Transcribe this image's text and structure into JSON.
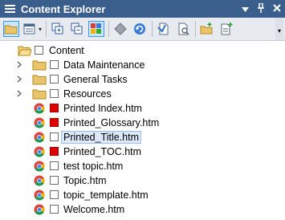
{
  "window": {
    "title": "Content Explorer",
    "pin_glyph": "⌄",
    "pushpin_glyph": "†",
    "close_glyph": "✕"
  },
  "toolbar": {
    "overflow_glyph": "▾"
  },
  "tree": {
    "root": {
      "label": "Content",
      "icon": "open-folder-icon"
    },
    "items": [
      {
        "label": "Data Maintenance",
        "icon": "folder-icon",
        "expandable": true,
        "checkbox": "empty"
      },
      {
        "label": "General Tasks",
        "icon": "folder-icon",
        "expandable": true,
        "checkbox": "empty"
      },
      {
        "label": "Resources",
        "icon": "folder-icon",
        "expandable": true,
        "checkbox": "empty"
      },
      {
        "label": "Printed Index.htm",
        "icon": "chrome-icon",
        "checkbox": "red"
      },
      {
        "label": "Printed_Glossary.htm",
        "icon": "chrome-icon",
        "checkbox": "red"
      },
      {
        "label": "Printed_Title.htm",
        "icon": "chrome-icon",
        "checkbox": "empty",
        "selected": true
      },
      {
        "label": "Printed_TOC.htm",
        "icon": "chrome-icon",
        "checkbox": "red"
      },
      {
        "label": "test topic.htm",
        "icon": "chrome-icon",
        "checkbox": "empty"
      },
      {
        "label": "Topic.htm",
        "icon": "chrome-icon",
        "checkbox": "empty"
      },
      {
        "label": "topic_template.htm",
        "icon": "chrome-icon",
        "checkbox": "empty"
      },
      {
        "label": "Welcome.htm",
        "icon": "chrome-icon",
        "checkbox": "empty"
      }
    ]
  },
  "colors": {
    "titlebar": "#3a5f8c",
    "toolbar": "#e7eaef",
    "selection_bg": "#dbe9fb",
    "selection_border": "#9cc0ee",
    "red_checkbox": "#e00000",
    "folder": "#e9c46a"
  }
}
